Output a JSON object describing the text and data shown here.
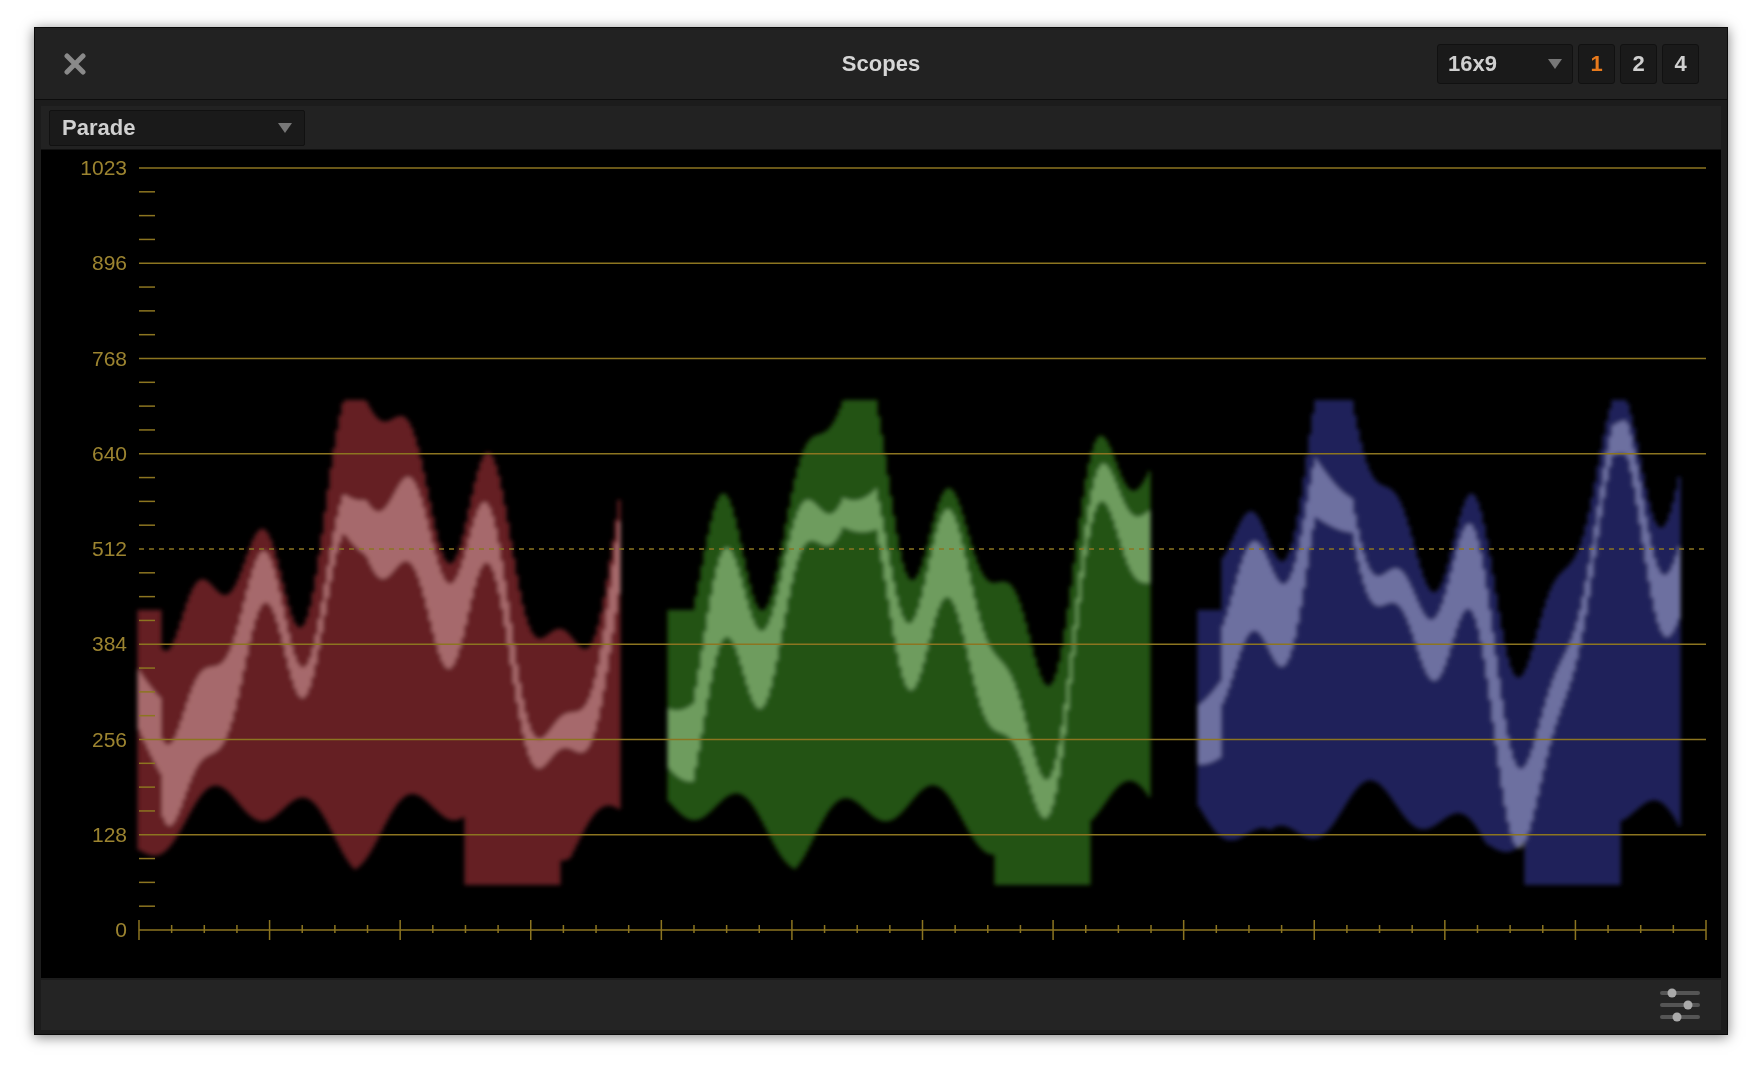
{
  "window": {
    "title": "Scopes"
  },
  "aspect_dropdown": {
    "value": "16x9"
  },
  "layout_buttons": [
    {
      "label": "1",
      "selected": true
    },
    {
      "label": "2",
      "selected": false
    },
    {
      "label": "4",
      "selected": false
    }
  ],
  "scope_dropdown": {
    "value": "Parade"
  },
  "scale_labels": [
    "1023",
    "896",
    "768",
    "640",
    "512",
    "384",
    "256",
    "128",
    "0"
  ]
}
